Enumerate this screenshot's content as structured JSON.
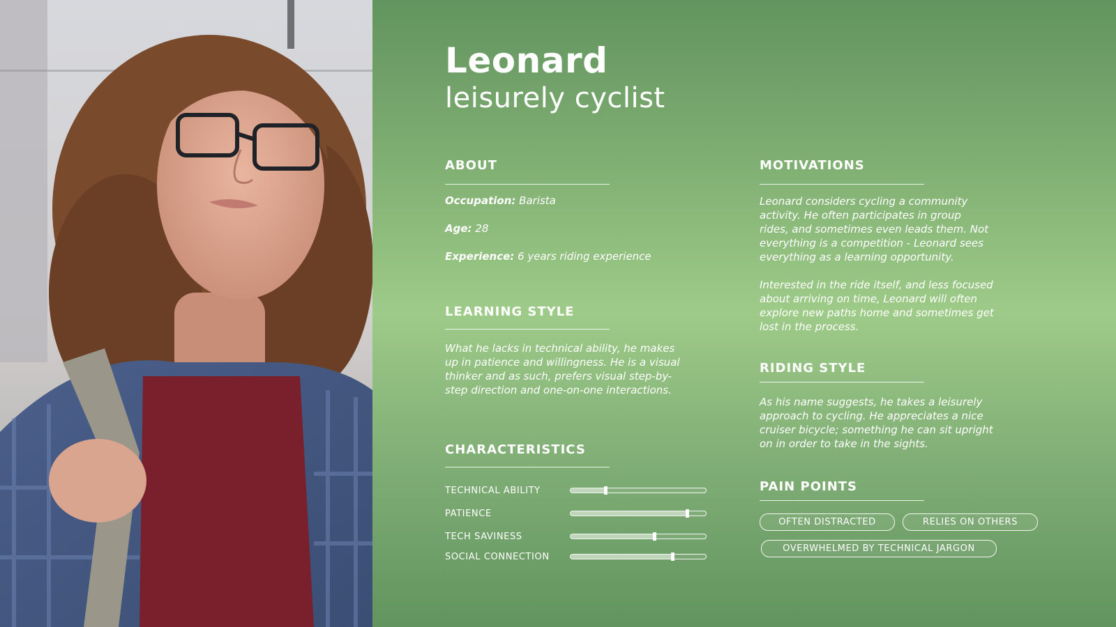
{
  "persona": {
    "name": "Leonard",
    "role": "leisurely  cyclist"
  },
  "about": {
    "heading": "ABOUT",
    "occupation_label": "Occupation:",
    "occupation_value": "Barista",
    "age_label": "Age:",
    "age_value": "28",
    "experience_label": "Experience:",
    "experience_value": "6 years riding experience"
  },
  "learning_style": {
    "heading": "LEARNING STYLE",
    "lines": [
      "What he lacks in technical ability, he makes",
      "up in patience and willingness. He is a visual",
      "thinker and as such, prefers visual step-by-",
      "step direction and one-on-one interactions."
    ]
  },
  "characteristics": {
    "heading": "CHARACTERISTICS",
    "items": [
      {
        "label": "TECHNICAL ABILITY",
        "level": 0.26
      },
      {
        "label": "PATIENCE",
        "level": 0.86
      },
      {
        "label": "TECH SAVINESS",
        "level": 0.62
      },
      {
        "label": "SOCIAL CONNECTION",
        "level": 0.75
      }
    ]
  },
  "motivations": {
    "heading": "MOTIVATIONS",
    "paragraph1": [
      "Leonard considers cycling a community",
      "activity. He often participates in group",
      "rides, and sometimes even leads them. Not",
      "everything is a competition - Leonard sees",
      "everything as a learning opportunity."
    ],
    "paragraph2": [
      "Interested in the ride itself, and less focused",
      "about arriving on time, Leonard will often",
      "explore new paths home and sometimes get",
      "lost in the process."
    ]
  },
  "riding_style": {
    "heading": "RIDING STYLE",
    "lines": [
      "As his name suggests, he takes a leisurely",
      "approach to cycling. He appreciates a nice",
      "cruiser bicycle; something he can sit upright",
      "on in order to take in the sights."
    ]
  },
  "pain_points": {
    "heading": "PAIN POINTS",
    "chips": [
      "OFTEN DISTRACTED",
      "RELIES ON OTHERS",
      "OVERWHELMED BY TECHNICAL JARGON"
    ]
  },
  "colors": {
    "panel_top": "#62945f",
    "panel_mid": "#9ecb88",
    "text": "#ffffff"
  }
}
